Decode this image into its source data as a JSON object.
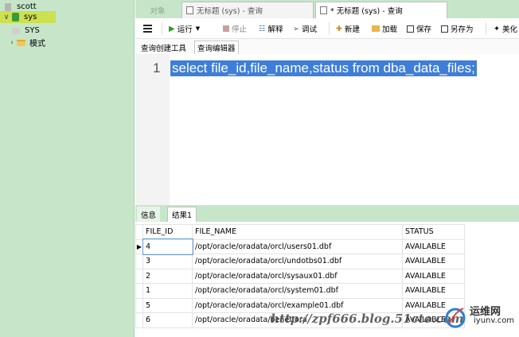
{
  "navigator": {
    "items": [
      {
        "label": "scott",
        "icon": "database-icon"
      },
      {
        "label": "sys",
        "icon": "database-connected-icon",
        "selected": true
      },
      {
        "label": "SYS",
        "icon": "schema-icon"
      },
      {
        "label": "模式",
        "icon": "folder-icon"
      }
    ]
  },
  "tabs": {
    "objects_label": "对象",
    "query1_label": "无标题 (sys) - 查询",
    "query2_label": "* 无标题 (sys) - 查询"
  },
  "toolbar": {
    "run_label": "运行",
    "stop_label": "停止",
    "explain_label": "解释",
    "debug_label": "调试",
    "new_label": "新建",
    "load_label": "加载",
    "save_label": "保存",
    "saveas_label": "另存为",
    "beautify_label": "美化"
  },
  "subtabs": {
    "builder_label": "查询创建工具",
    "editor_label": "查询编辑器"
  },
  "editor": {
    "line_number": "1",
    "sql": "select file_id,file_name,status from dba_data_files;"
  },
  "result_tabs": {
    "info_label": "信息",
    "result_label": "结果1"
  },
  "result": {
    "columns": [
      "FILE_ID",
      "FILE_NAME",
      "STATUS"
    ],
    "rows": [
      [
        "4",
        "/opt/oracle/oradata/orcl/users01.dbf",
        "AVAILABLE"
      ],
      [
        "3",
        "/opt/oracle/oradata/orcl/undotbs01.dbf",
        "AVAILABLE"
      ],
      [
        "2",
        "/opt/oracle/oradata/orcl/sysaux01.dbf",
        "AVAILABLE"
      ],
      [
        "1",
        "/opt/oracle/oradata/orcl/system01.dbf",
        "AVAILABLE"
      ],
      [
        "5",
        "/opt/oracle/oradata/orcl/example01.dbf",
        "AVAILABLE"
      ],
      [
        "6",
        "/opt/oracle/oradata/benet.ora",
        "AVAILABLE"
      ]
    ]
  },
  "watermark": {
    "text": "http://zpf666.blog.51cto.com",
    "logo_text": "运维网",
    "logo_sub": "iyunv.com"
  },
  "colors": {
    "navigator_bg": "#c7e6c9",
    "selection_highlight": "#cde050",
    "sql_selection": "#3f7ed8"
  }
}
